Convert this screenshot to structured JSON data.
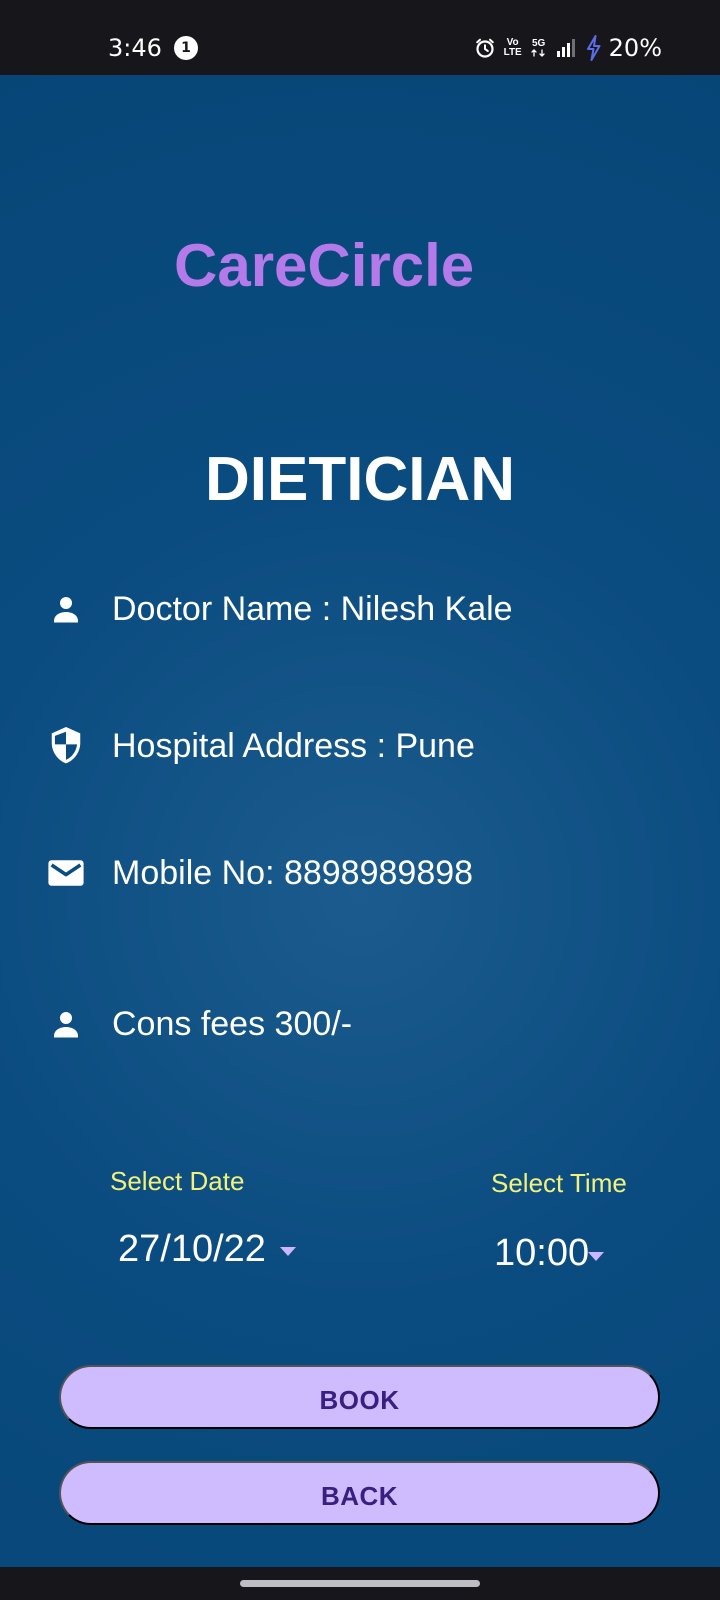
{
  "status_bar": {
    "time": "3:46",
    "notification_count": "1",
    "network_vo": "Vo",
    "network_lte": "LTE",
    "network_5g": "5G",
    "battery": "20%"
  },
  "app": {
    "title": "CareCircle",
    "page_title": "DIETICIAN"
  },
  "details": {
    "doctor": "Doctor Name : Nilesh Kale",
    "hospital": "Hospital Address : Pune",
    "mobile": "Mobile No: 8898989898",
    "fees": "Cons fees 300/-"
  },
  "booking": {
    "date_label": "Select Date",
    "date_value": "27/10/22",
    "time_label": "Select Time",
    "time_value": "10:00"
  },
  "actions": {
    "book": "BOOK",
    "back": "BACK"
  },
  "colors": {
    "title": "#b47ae9",
    "accent_labels": "#f4f17a",
    "button_bg": "#cfbcff",
    "button_text": "#3a1f80",
    "background": "#0b4c80"
  },
  "icons": {
    "doctor": "person-icon",
    "hospital": "shield-icon",
    "mobile": "mail-icon",
    "fees": "person-icon",
    "alarm": "alarm-icon",
    "signal": "signal-icon",
    "charging": "charging-icon"
  }
}
